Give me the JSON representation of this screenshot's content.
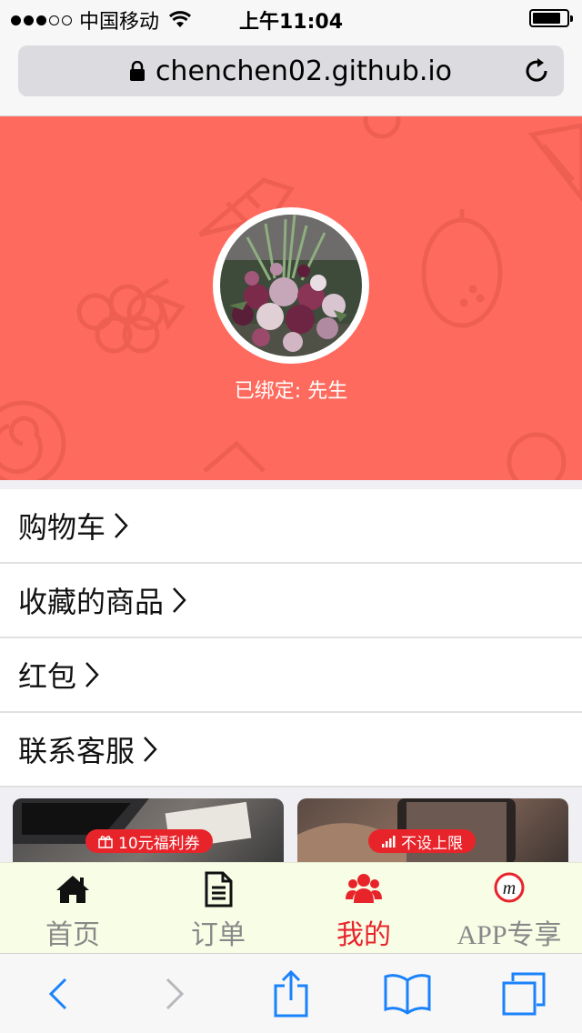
{
  "status_bar": {
    "carrier": "中国移动",
    "time": "上午11:04",
    "signal_bars_filled": 3,
    "signal_bars_total": 5,
    "battery_level": 0.82
  },
  "browser": {
    "url": "chenchen02.github.io"
  },
  "profile": {
    "bound_label": "已绑定: 先生"
  },
  "menu": {
    "items": [
      {
        "label": "购物车"
      },
      {
        "label": "收藏的商品"
      },
      {
        "label": "红包"
      },
      {
        "label": "联系客服"
      }
    ]
  },
  "promos": [
    {
      "badge": "10元福利券"
    },
    {
      "badge": "不设上限"
    }
  ],
  "tabbar": {
    "items": [
      {
        "label": "首页",
        "icon": "home-icon"
      },
      {
        "label": "订单",
        "icon": "document-icon"
      },
      {
        "label": "我的",
        "icon": "users-icon",
        "active": true
      },
      {
        "label": "APP专享",
        "icon": "app-logo-icon"
      }
    ],
    "active_color": "#e8242b"
  },
  "colors": {
    "hero_bg": "#fe6b5e",
    "safari_blue": "#1a82fb"
  }
}
